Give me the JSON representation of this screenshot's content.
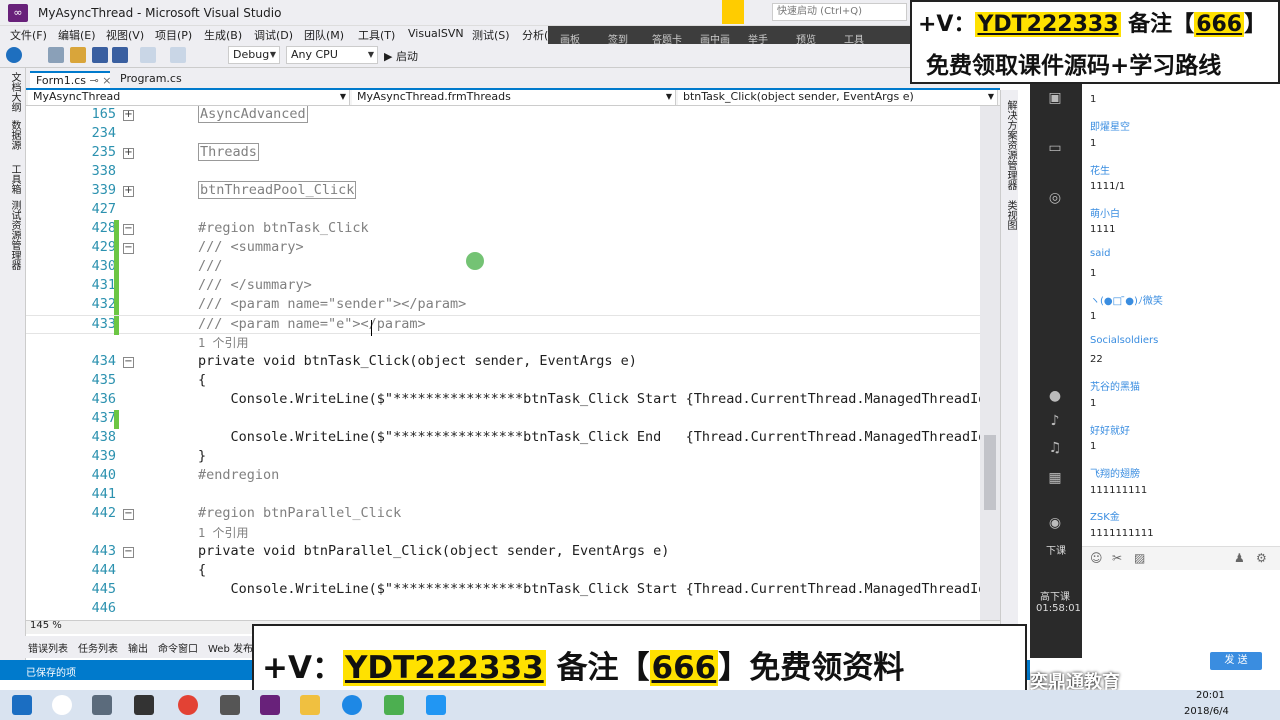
{
  "window": {
    "title": "MyAsyncThread - Microsoft Visual Studio",
    "quick_launch": "快速启动 (Ctrl+Q)"
  },
  "menu": [
    "文件(F)",
    "编辑(E)",
    "视图(V)",
    "项目(P)",
    "生成(B)",
    "调试(D)",
    "团队(M)",
    "工具(T)",
    "VisualSVN",
    "测试(S)",
    "分析("
  ],
  "toolbar": {
    "config": "Debug",
    "platform": "Any CPU",
    "start_label": "▶ 启动"
  },
  "live_bar": [
    "画板",
    "签到",
    "答题卡",
    "画中画",
    "举手",
    "预览",
    "工具"
  ],
  "left_strip": [
    "文档大纲",
    "数据源",
    "工具箱",
    "测试资源管理器"
  ],
  "tabs": [
    {
      "label": "Form1.cs"
    },
    {
      "label": "Program.cs"
    }
  ],
  "nav": {
    "project": "MyAsyncThread",
    "class": "MyAsyncThread.frmThreads",
    "member": "btnTask_Click(object sender, EventArgs e)"
  },
  "code": {
    "lines": [
      {
        "n": "165",
        "text": "AsyncAdvanced"
      },
      {
        "n": "234",
        "text": ""
      },
      {
        "n": "235",
        "text": "Threads"
      },
      {
        "n": "338",
        "text": ""
      },
      {
        "n": "339",
        "text": "btnThreadPool_Click"
      },
      {
        "n": "427",
        "text": ""
      },
      {
        "n": "428",
        "text": "#region btnTask_Click"
      },
      {
        "n": "429",
        "text": "/// <summary>"
      },
      {
        "n": "430",
        "text": "///"
      },
      {
        "n": "431",
        "text": "/// </summary>"
      },
      {
        "n": "432",
        "text": "/// <param name=\"sender\"></param>"
      },
      {
        "n": "433",
        "text": "/// <param name=\"e\"></param>"
      },
      {
        "n": "",
        "text": "1 个引用"
      },
      {
        "n": "434",
        "text": "private void btnTask_Click(object sender, EventArgs e)"
      },
      {
        "n": "435",
        "text": "{"
      },
      {
        "n": "436",
        "text": "    Console.WriteLine($\"****************btnTask_Click Start {Thread.CurrentThread.ManagedThreadId.To"
      },
      {
        "n": "437",
        "text": ""
      },
      {
        "n": "438",
        "text": "    Console.WriteLine($\"****************btnTask_Click End   {Thread.CurrentThread.ManagedThreadId.To"
      },
      {
        "n": "439",
        "text": "}"
      },
      {
        "n": "440",
        "text": "#endregion"
      },
      {
        "n": "441",
        "text": ""
      },
      {
        "n": "442",
        "text": "#region btnParallel_Click"
      },
      {
        "n": "",
        "text": "1 个引用"
      },
      {
        "n": "443",
        "text": "private void btnParallel_Click(object sender, EventArgs e)"
      },
      {
        "n": "444",
        "text": "{"
      },
      {
        "n": "445",
        "text": "    Console.WriteLine($\"****************btnTask_Click Start {Thread.CurrentThread.ManagedThreadId.To"
      },
      {
        "n": "446",
        "text": ""
      }
    ]
  },
  "zoom": "145 %",
  "bottom_tabs": [
    "错误列表",
    "任务列表",
    "输出",
    "命令窗口",
    "Web 发布"
  ],
  "status": "已保存的项",
  "right_strip": [
    "解决方案资源管理器",
    "类视图"
  ],
  "live": {
    "ended": "高下课",
    "timer": "01:58:01",
    "end_label": "下课"
  },
  "chat": [
    {
      "name": "",
      "msg": "1"
    },
    {
      "name": "即燿星空",
      "msg": "1"
    },
    {
      "name": "花生",
      "msg": "1111/1"
    },
    {
      "name": "萌小白",
      "msg": "1111"
    },
    {
      "name": "said",
      "msg": "1"
    },
    {
      "name": "ヽ(●□ ̄●)ﾉ微笑",
      "msg": "1"
    },
    {
      "name": "Socialsoldiers",
      "msg": "22"
    },
    {
      "name": "艽谷的黑猫",
      "msg": "1"
    },
    {
      "name": "好好就好",
      "msg": "1"
    },
    {
      "name": "飞翔的翅膀",
      "msg": "111111111"
    },
    {
      "name": "ZSK金",
      "msg": "1111111111"
    }
  ],
  "send_label": "发 送",
  "promo": {
    "top_line1_prefix": "+V：",
    "top_line1_id": "YDT222333",
    "top_line1_mid": " 备注【",
    "top_line1_code": "666",
    "top_line1_end": "】",
    "top_line2": "免费领取课件源码+学习路线",
    "bottom_prefix": "+V：",
    "bottom_id": "YDT222333",
    "bottom_mid": " 备注【",
    "bottom_code": "666",
    "bottom_end": "】免费领资料"
  },
  "watermark": "奕鼎通教育",
  "clock": {
    "time": "20:01",
    "date": "2018/6/4"
  },
  "colors": {
    "accent": "#007acc",
    "region_green": "#6cc644",
    "keyword": "#0000ff",
    "type": "#2b91af",
    "promo_highlight": "#ffe100"
  }
}
